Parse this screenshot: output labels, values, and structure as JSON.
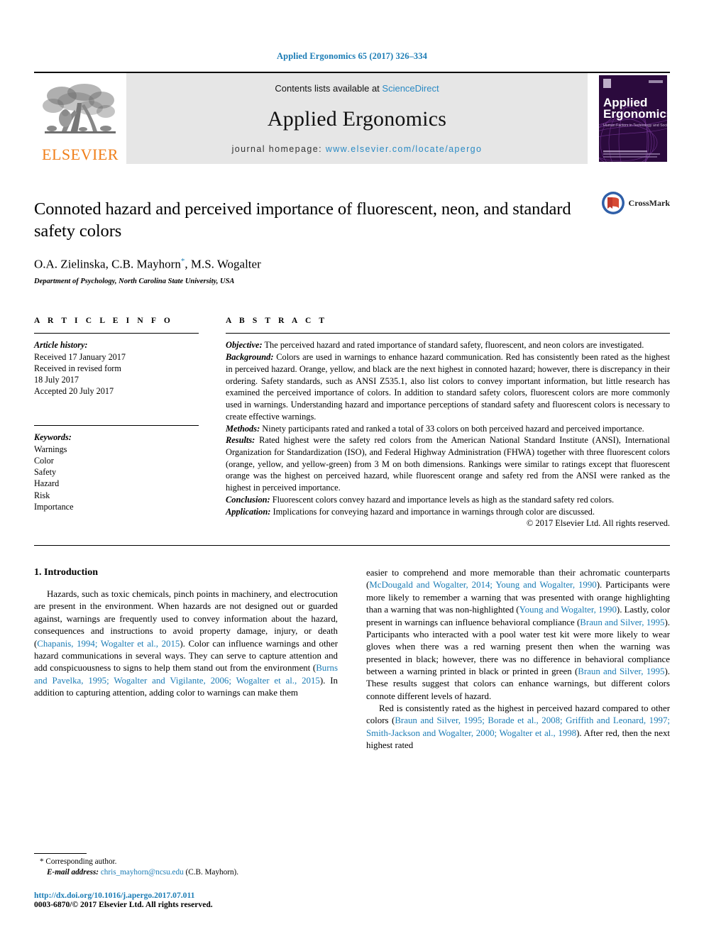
{
  "running_head": "Applied Ergonomics 65 (2017) 326–334",
  "header": {
    "publisher_name": "ELSEVIER",
    "contents_prefix": "Contents lists available at ",
    "contents_link": "ScienceDirect",
    "journal_name": "Applied Ergonomics",
    "homepage_prefix": "journal homepage: ",
    "homepage_url": "www.elsevier.com/locate/apergo",
    "cover": {
      "line1": "Applied",
      "line2": "Ergonomics",
      "tagline": "Human Factors in Technology and Society"
    },
    "colors": {
      "link_blue": "#2a8ac4",
      "elsevier_orange": "#f07f1a",
      "band_gray": "#e6e6e6",
      "cover_purple": "#2b0a3d"
    }
  },
  "title_block": {
    "title": "Connoted hazard and perceived importance of fluorescent, neon, and standard safety colors",
    "authors": "O.A. Zielinska, C.B. Mayhorn",
    "authors_tail": ", M.S. Wogalter",
    "corresponding_marker": "*",
    "affiliation": "Department of Psychology, North Carolina State University, USA",
    "crossmark_label": "CrossMark"
  },
  "article_info": {
    "heading": "A R T I C L E   I N F O",
    "history_label": "Article history:",
    "history": [
      "Received 17 January 2017",
      "Received in revised form",
      "18 July 2017",
      "Accepted 20 July 2017"
    ],
    "keywords_label": "Keywords:",
    "keywords": [
      "Warnings",
      "Color",
      "Safety",
      "Hazard",
      "Risk",
      "Importance"
    ]
  },
  "abstract": {
    "heading": "A B S T R A C T",
    "sections": [
      {
        "label": "Objective:",
        "text": " The perceived hazard and rated importance of standard safety, fluorescent, and neon colors are investigated."
      },
      {
        "label": "Background:",
        "text": " Colors are used in warnings to enhance hazard communication. Red has consistently been rated as the highest in perceived hazard. Orange, yellow, and black are the next highest in connoted hazard; however, there is discrepancy in their ordering. Safety standards, such as ANSI Z535.1, also list colors to convey important information, but little research has examined the perceived importance of colors. In addition to standard safety colors, fluorescent colors are more commonly used in warnings. Understanding hazard and importance perceptions of standard safety and fluorescent colors is necessary to create effective warnings."
      },
      {
        "label": "Methods:",
        "text": " Ninety participants rated and ranked a total of 33 colors on both perceived hazard and perceived importance."
      },
      {
        "label": "Results:",
        "text": " Rated highest were the safety red colors from the American National Standard Institute (ANSI), International Organization for Standardization (ISO), and Federal Highway Administration (FHWA) together with three fluorescent colors (orange, yellow, and yellow-green) from 3 M on both dimensions. Rankings were similar to ratings except that fluorescent orange was the highest on perceived hazard, while fluorescent orange and safety red from the ANSI were ranked as the highest in perceived importance."
      },
      {
        "label": "Conclusion:",
        "text": " Fluorescent colors convey hazard and importance levels as high as the standard safety red colors."
      },
      {
        "label": "Application:",
        "text": " Implications for conveying hazard and importance in warnings through color are discussed."
      }
    ],
    "copyright": "© 2017 Elsevier Ltd. All rights reserved."
  },
  "body": {
    "section_heading": "1. Introduction",
    "left_column": [
      {
        "indent": true,
        "runs": [
          {
            "t": "Hazards, such as toxic chemicals, pinch points in machinery, and electrocution are present in the environment. When hazards are not designed out or guarded against, warnings are frequently used to convey information about the hazard, consequences and instructions to avoid property damage, injury, or death (",
            "cite": false
          },
          {
            "t": "Chapanis, 1994; Wogalter et al., 2015",
            "cite": true
          },
          {
            "t": "). Color can influence warnings and other hazard communications in several ways. They can serve to capture attention and add conspicuousness to signs to help them stand out from the environment (",
            "cite": false
          },
          {
            "t": "Burns and Pavelka, 1995; Wogalter and Vigilante, 2006; Wogalter et al., 2015",
            "cite": true
          },
          {
            "t": "). In addition to capturing attention, adding color to warnings can make them",
            "cite": false
          }
        ]
      }
    ],
    "right_column": [
      {
        "indent": false,
        "runs": [
          {
            "t": "easier to comprehend and more memorable than their achromatic counterparts (",
            "cite": false
          },
          {
            "t": "McDougald and Wogalter, 2014; Young and Wogalter, 1990",
            "cite": true
          },
          {
            "t": "). Participants were more likely to remember a warning that was presented with orange highlighting than a warning that was non-highlighted (",
            "cite": false
          },
          {
            "t": "Young and Wogalter, 1990",
            "cite": true
          },
          {
            "t": "). Lastly, color present in warnings can influence behavioral compliance (",
            "cite": false
          },
          {
            "t": "Braun and Silver, 1995",
            "cite": true
          },
          {
            "t": "). Participants who interacted with a pool water test kit were more likely to wear gloves when there was a red warning present then when the warning was presented in black; however, there was no difference in behavioral compliance between a warning printed in black or printed in green (",
            "cite": false
          },
          {
            "t": "Braun and Silver, 1995",
            "cite": true
          },
          {
            "t": "). These results suggest that colors can enhance warnings, but different colors connote different levels of hazard.",
            "cite": false
          }
        ]
      },
      {
        "indent": true,
        "runs": [
          {
            "t": "Red is consistently rated as the highest in perceived hazard compared to other colors (",
            "cite": false
          },
          {
            "t": "Braun and Silver, 1995; Borade et al., 2008; Griffith and Leonard, 1997; Smith-Jackson and Wogalter, 2000; Wogalter et al., 1998",
            "cite": true
          },
          {
            "t": "). After red, then the next highest rated",
            "cite": false
          }
        ]
      }
    ]
  },
  "footer": {
    "corresponding_marker": "*",
    "corresponding_text": "Corresponding author.",
    "email_label": "E-mail address:",
    "email": "chris_mayhorn@ncsu.edu",
    "email_owner": "(C.B. Mayhorn).",
    "doi": "http://dx.doi.org/10.1016/j.apergo.2017.07.011",
    "issn_line": "0003-6870/© 2017 Elsevier Ltd. All rights reserved."
  }
}
